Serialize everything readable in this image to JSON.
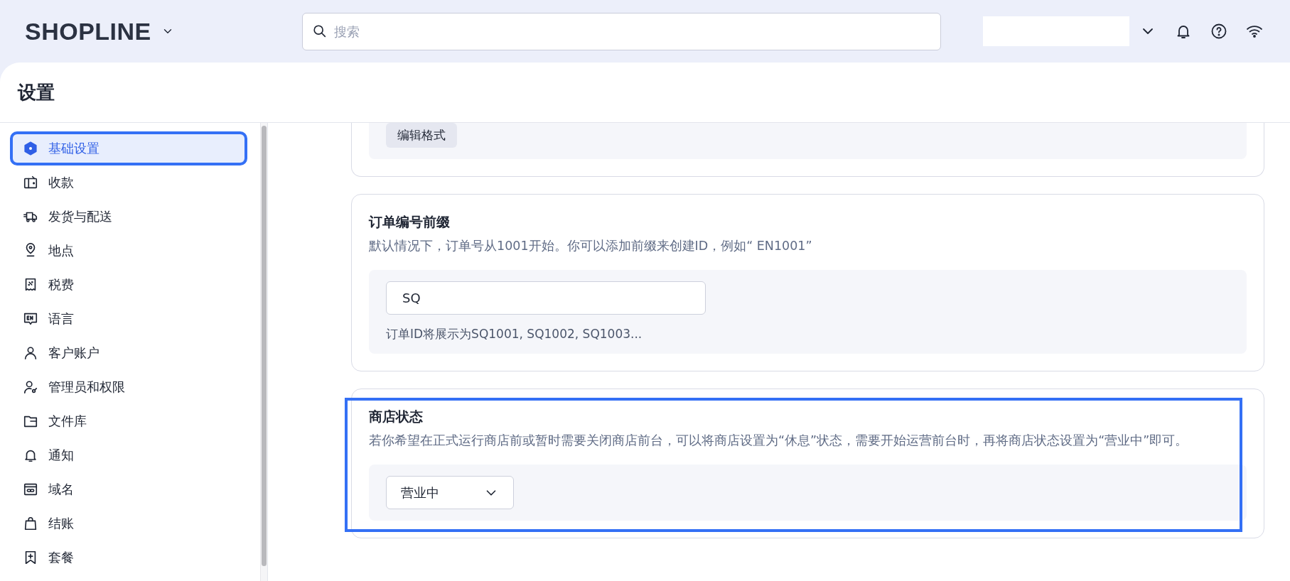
{
  "topbar": {
    "logo": "SHOPLINE",
    "search": {
      "placeholder": "搜索"
    }
  },
  "page": {
    "title": "设置"
  },
  "sidebar": {
    "items": [
      {
        "label": "基础设置",
        "selected": true,
        "highlighted": true
      },
      {
        "label": "收款",
        "selected": false,
        "highlighted": false
      },
      {
        "label": "发货与配送",
        "selected": false,
        "highlighted": false
      },
      {
        "label": "地点",
        "selected": false,
        "highlighted": false
      },
      {
        "label": "税费",
        "selected": false,
        "highlighted": false
      },
      {
        "label": "语言",
        "selected": false,
        "highlighted": false
      },
      {
        "label": "客户账户",
        "selected": false,
        "highlighted": false
      },
      {
        "label": "管理员和权限",
        "selected": false,
        "highlighted": false
      },
      {
        "label": "文件库",
        "selected": false,
        "highlighted": false
      },
      {
        "label": "通知",
        "selected": false,
        "highlighted": false
      },
      {
        "label": "域名",
        "selected": false,
        "highlighted": false
      },
      {
        "label": "结账",
        "selected": false,
        "highlighted": false
      },
      {
        "label": "套餐",
        "selected": false,
        "highlighted": false
      }
    ]
  },
  "sections": [
    {
      "kind": "button",
      "button": "编辑格式",
      "highlighted": false
    },
    {
      "kind": "input",
      "title": "订单编号前缀",
      "description": "默认情况下，订单号从1001开始。你可以添加前缀来创建ID，例如“ EN1001”",
      "value": "SQ",
      "hint": "订单ID将展示为SQ1001, SQ1002, SQ1003...",
      "highlighted": false
    },
    {
      "kind": "select",
      "title": "商店状态",
      "description": "若你希望在正式运行商店前或暂时需要关闭商店前台，可以将商店设置为“休息”状态，需要开始运营前台时，再将商店状态设置为“营业中”即可。",
      "value": "营业中",
      "highlighted": true
    }
  ]
}
